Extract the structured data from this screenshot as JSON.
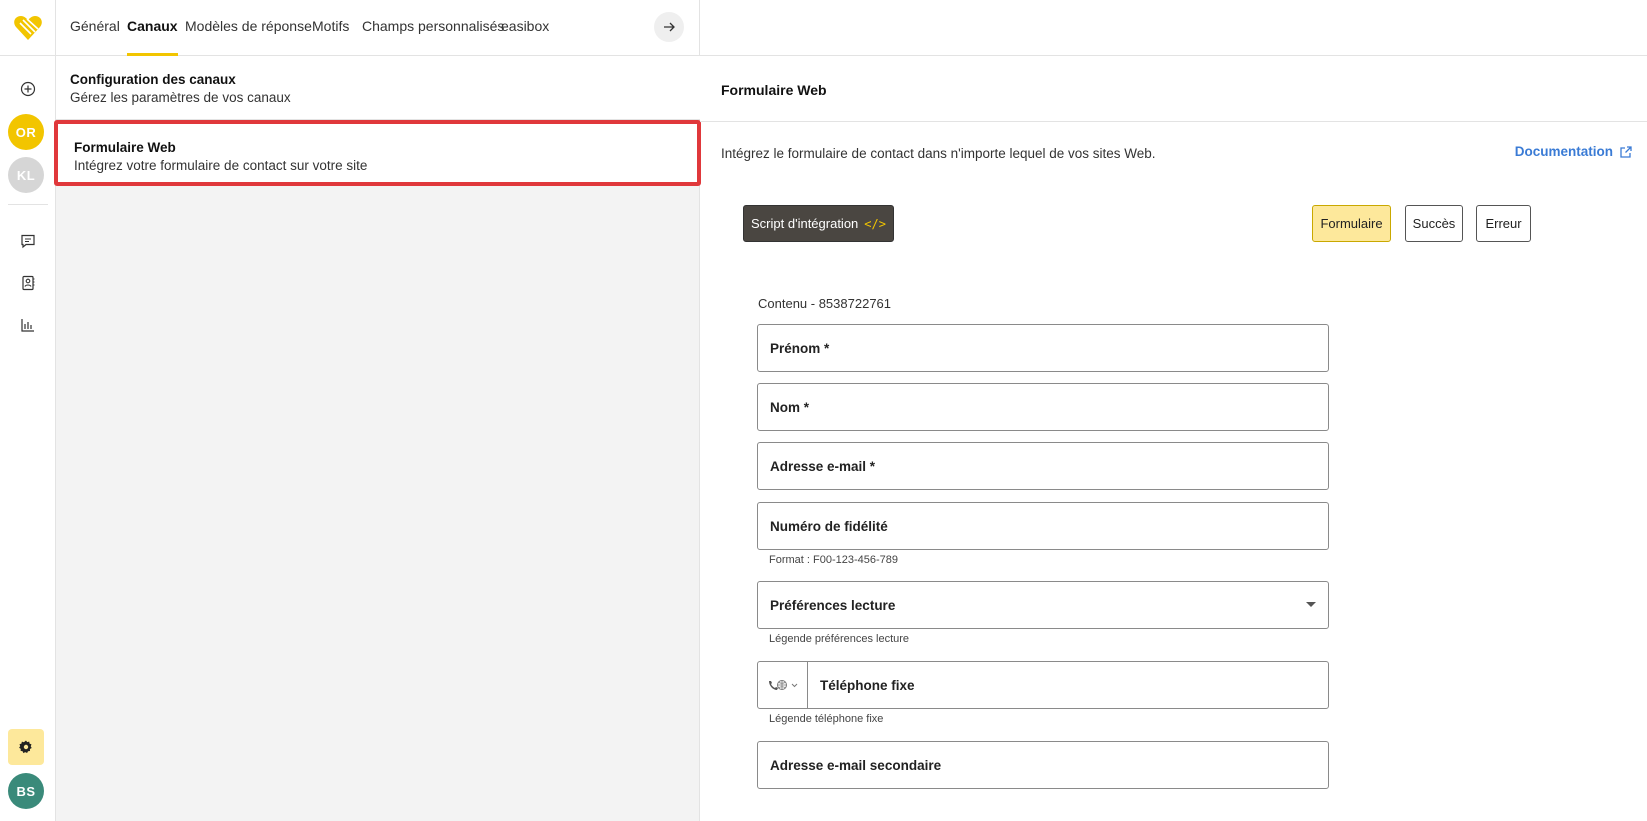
{
  "rail": {
    "avatars": [
      {
        "initials": "OR",
        "color": "#f2c500"
      },
      {
        "initials": "KL",
        "color": "#d6d6d6"
      }
    ],
    "user": {
      "initials": "BS",
      "color": "#3a8a7a"
    },
    "icons": [
      "add-circle-icon",
      "chat-icon",
      "contact-card-icon",
      "bar-chart-icon",
      "gear-icon"
    ],
    "accent": "#f2c500"
  },
  "tabs": [
    {
      "label": "Général",
      "active": false
    },
    {
      "label": "Canaux",
      "active": true
    },
    {
      "label": "Modèles de réponse",
      "active": false
    },
    {
      "label": "Motifs",
      "active": false
    },
    {
      "label": "Champs personnalisés",
      "active": false
    },
    {
      "label": "easibox",
      "active": false
    }
  ],
  "list": [
    {
      "title": "Configuration des canaux",
      "subtitle": "Gérez les paramètres de vos canaux"
    },
    {
      "title": "Formulaire Web",
      "subtitle": "Intégrez votre formulaire de contact sur votre site",
      "selected": true
    }
  ],
  "panel": {
    "title": "Formulaire Web",
    "description": "Intégrez le formulaire de contact dans n'importe lequel de vos sites Web.",
    "doc_link": "Documentation",
    "script_button": "Script d'intégration",
    "script_icon": "</>",
    "views": [
      {
        "label": "Formulaire",
        "active": true
      },
      {
        "label": "Succès",
        "active": false
      },
      {
        "label": "Erreur",
        "active": false
      }
    ],
    "content_label": "Contenu - 8538722761",
    "fields": {
      "first_name": "Prénom *",
      "last_name": "Nom *",
      "email": "Adresse e-mail *",
      "loyalty": "Numéro de fidélité",
      "loyalty_hint": "Format : F00-123-456-789",
      "reading_prefs": "Préférences lecture",
      "reading_prefs_hint": "Légende préférences lecture",
      "landline": "Téléphone fixe",
      "landline_hint": "Légende téléphone fixe",
      "secondary_email": "Adresse e-mail secondaire"
    }
  }
}
